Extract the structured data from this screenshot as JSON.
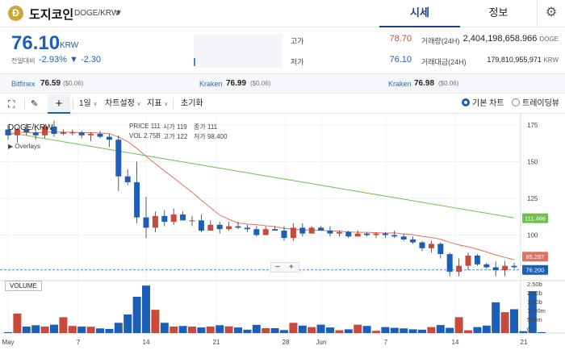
{
  "header": {
    "coin_symbol": "Ð",
    "coin_name": "도지코인",
    "pair": "DOGE/KRW",
    "pair_caret": "▼",
    "tabs": [
      {
        "label": "시세"
      },
      {
        "label": "정보"
      }
    ],
    "settings_icon": "gear-icon"
  },
  "price": {
    "current": "76.10",
    "unit": "KRW",
    "change_label": "전일대비",
    "change_pct": "-2.93%",
    "change_abs": "▼ -2.30",
    "high_label": "고가",
    "high": "78.70",
    "low_label": "저가",
    "low": "76.10",
    "volume_label": "거래량(24H)",
    "volume": "2,404,198,658.966",
    "volume_unit": "DOGE",
    "amount_label": "거래대금(24H)",
    "amount": "179,810,955,971",
    "amount_unit": "KRW"
  },
  "exchanges": [
    {
      "name": "Bitfinex",
      "price": "76.59",
      "diff": "($0.06)"
    },
    {
      "name": "Kraken",
      "price": "76.99",
      "diff": "($0.06)"
    },
    {
      "name": "Kraken",
      "price": "76.98",
      "diff": "($0.06)"
    }
  ],
  "toolbar": {
    "fullscreen_icon": "fullscreen-icon",
    "draw_icon": "pencil-icon",
    "crosshair_icon": "crosshair-icon",
    "interval": "1일",
    "chart_settings": "차트설정",
    "indicators": "지표",
    "reset": "초기화",
    "basic_chart": "기본 차트",
    "tradingview": "트레이딩뷰"
  },
  "legend": {
    "symbol": "DOGE/KRW",
    "overlays": "Overlays",
    "price_label": "PRICE",
    "price": "111",
    "open_label": "시가",
    "open": "119",
    "close_label": "종가",
    "close": "111",
    "vol_label": "VOL",
    "vol": "2.75B",
    "high_label": "고가",
    "high": "122",
    "low_label": "저가",
    "low": "98.400"
  },
  "volume_label": "VOLUME",
  "zoom": {
    "minus": "−",
    "plus": "+"
  },
  "colors": {
    "up": "#c84a3a",
    "down": "#1d5fb8",
    "ma_short": "#e0715f",
    "ma_long": "#6fbf4e",
    "accent": "#1c3f8f"
  },
  "chart_data": {
    "type": "candlestick",
    "x_labels": [
      "May",
      "7",
      "14",
      "21",
      "28",
      "Jun",
      "7",
      "14",
      "21"
    ],
    "price_ticks": [
      175,
      150,
      125,
      100,
      75
    ],
    "volume_ticks": [
      "2.50b",
      "2.00b",
      "1.50b",
      "1000m",
      "500m",
      "0"
    ],
    "ylim": [
      70,
      180
    ],
    "markers": [
      {
        "label": "111.466",
        "value": 111.466,
        "color": "#6fbf4e"
      },
      {
        "label": "85.287",
        "value": 85.287,
        "color": "#e0715f"
      },
      {
        "label": "76.200",
        "value": 76.2,
        "color": "#1d5fb8"
      }
    ],
    "candles": [
      [
        172,
        175,
        165,
        168
      ],
      [
        168,
        173,
        163,
        172
      ],
      [
        172,
        176,
        168,
        170
      ],
      [
        170,
        172,
        165,
        168
      ],
      [
        168,
        175,
        166,
        174
      ],
      [
        174,
        178,
        167,
        169
      ],
      [
        169,
        172,
        168,
        170
      ],
      [
        170,
        172,
        168,
        170
      ],
      [
        170,
        171,
        166,
        168
      ],
      [
        168,
        170,
        164,
        169
      ],
      [
        169,
        171,
        166,
        167
      ],
      [
        167,
        169,
        160,
        165
      ],
      [
        165,
        168,
        130,
        140
      ],
      [
        140,
        145,
        134,
        136
      ],
      [
        136,
        150,
        108,
        112
      ],
      [
        112,
        126,
        98,
        105
      ],
      [
        105,
        116,
        102,
        113
      ],
      [
        113,
        117,
        106,
        109
      ],
      [
        109,
        118,
        107,
        114
      ],
      [
        114,
        116,
        110,
        110
      ],
      [
        110,
        113,
        106,
        110
      ],
      [
        110,
        114,
        102,
        103
      ],
      [
        103,
        110,
        103,
        107
      ],
      [
        107,
        109,
        101,
        104
      ],
      [
        104,
        109,
        103,
        106
      ],
      [
        106,
        109,
        104,
        105
      ],
      [
        105,
        107,
        102,
        104
      ],
      [
        104,
        106,
        99,
        100
      ],
      [
        100,
        106,
        100,
        104
      ],
      [
        104,
        106,
        103,
        103
      ],
      [
        103,
        106,
        96,
        98
      ],
      [
        98,
        108,
        96,
        105
      ],
      [
        105,
        108,
        99,
        101
      ],
      [
        101,
        106,
        101,
        105
      ],
      [
        105,
        106,
        103,
        103
      ],
      [
        103,
        106,
        99,
        101
      ],
      [
        101,
        103,
        99,
        102
      ],
      [
        102,
        103,
        98,
        99
      ],
      [
        99,
        103,
        99,
        101
      ],
      [
        101,
        102,
        99,
        100
      ],
      [
        100,
        102,
        98,
        101
      ],
      [
        101,
        102,
        98,
        100
      ],
      [
        100,
        103,
        98,
        99
      ],
      [
        99,
        101,
        96,
        97
      ],
      [
        97,
        99,
        94,
        95
      ],
      [
        95,
        96,
        89,
        91
      ],
      [
        91,
        96,
        88,
        94
      ],
      [
        94,
        95,
        84,
        87
      ],
      [
        87,
        88,
        72,
        75
      ],
      [
        75,
        84,
        72,
        79
      ],
      [
        79,
        88,
        76,
        86
      ],
      [
        86,
        87,
        79,
        80
      ],
      [
        80,
        81,
        77,
        78
      ],
      [
        78,
        82,
        72,
        76
      ],
      [
        76,
        82,
        72,
        79
      ],
      [
        79,
        81,
        77,
        78
      ]
    ],
    "volumes": [
      0.05,
      1.05,
      0.35,
      0.42,
      0.35,
      0.45,
      0.85,
      0.38,
      0.35,
      0.34,
      0.25,
      0.22,
      0.55,
      1.0,
      1.95,
      2.55,
      1.25,
      0.55,
      0.35,
      0.38,
      0.35,
      0.3,
      0.35,
      0.42,
      0.36,
      0.3,
      0.18,
      0.44,
      0.26,
      0.26,
      0.16,
      0.55,
      0.4,
      0.32,
      0.45,
      0.3,
      0.15,
      0.2,
      0.45,
      0.38,
      0.12,
      0.32,
      0.28,
      0.25,
      0.2,
      0.18,
      0.32,
      0.43,
      0.28,
      0.85,
      0.15,
      0.32,
      0.4,
      1.65,
      1.12,
      1.28,
      0.1,
      2.25,
      0.05
    ]
  }
}
